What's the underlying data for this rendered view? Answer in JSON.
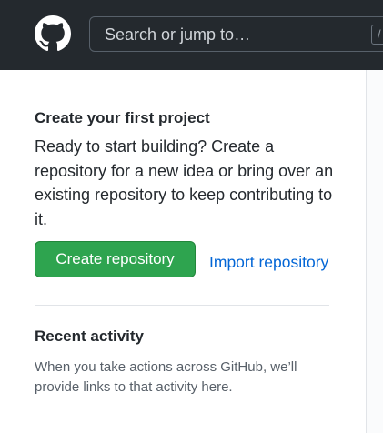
{
  "header": {
    "logo": "github-logo",
    "search_placeholder": "Search or jump to…",
    "search_shortcut": "/"
  },
  "first_project": {
    "title": "Create your first project",
    "description": "Ready to start building? Create a repository for a new idea or bring over an existing repository to keep contributing to it.",
    "create_button": "Create repository",
    "import_link": "Import repository"
  },
  "recent_activity": {
    "title": "Recent activity",
    "description": "When you take actions across GitHub, we’ll provide links to that activity here."
  },
  "colors": {
    "header_bg": "#24292e",
    "primary_button": "#2ea44f",
    "link": "#0366d6"
  }
}
